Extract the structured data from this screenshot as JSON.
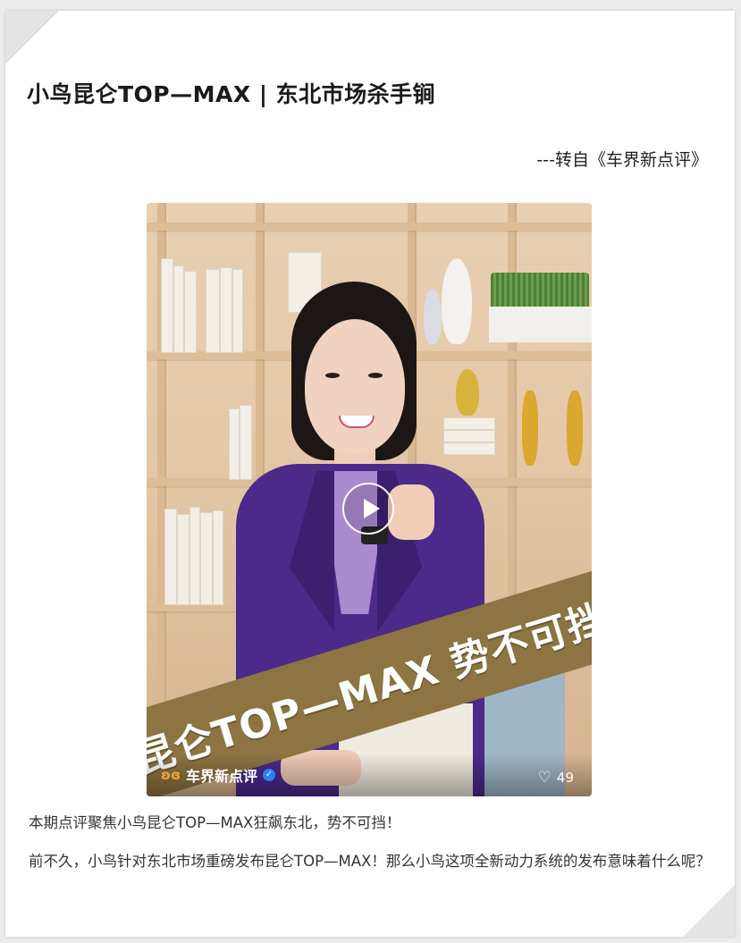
{
  "article": {
    "title": "小鸟昆仑TOP—MAX | 东北市场杀手锏",
    "source": "---转自《车界新点评》"
  },
  "video": {
    "banner_text": "昆仑TOP—MAX  势不可挡",
    "channel_name": "车界新点评",
    "channel_logo_icon": "butterfly-logo-icon",
    "verified_icon": "verified-check-icon",
    "like_icon": "heart-outline-icon",
    "like_count": "49",
    "play_icon": "play-icon"
  },
  "body": {
    "paragraph_1": "本期点评聚焦小鸟昆仑TOP—MAX狂飙东北，势不可挡！",
    "paragraph_2": "前不久，小鸟针对东北市场重磅发布昆仑TOP—MAX！那么小鸟这项全新动力系统的发布意味着什么呢？"
  },
  "colors": {
    "jacket": "#4b2a8a",
    "banner": "#8d7442",
    "verified": "#2f7cf6",
    "logo": "#f2a23a"
  }
}
